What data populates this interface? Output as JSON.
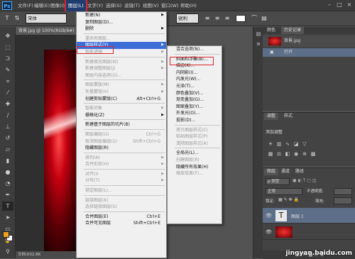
{
  "app": {
    "logo": "Ps"
  },
  "menubar": {
    "items": [
      "文件(F)",
      "编辑(E)",
      "图像(I)",
      "图层(L)",
      "文字(Y)",
      "选择(S)",
      "滤镜(T)",
      "视图(V)",
      "窗口(W)",
      "帮助(H)"
    ],
    "active_index": 3
  },
  "window_controls": {
    "minimize": "–",
    "maximize": "□",
    "close": "×"
  },
  "options": {
    "font_family": "宋体",
    "font_style": "锐利",
    "font_size": "T"
  },
  "document": {
    "tab_label": "背景.jpg @ 100%(RGB/8#)",
    "status": "文档:632.8K"
  },
  "layer_menu": {
    "items": [
      {
        "label": "新建(N)",
        "shortcut": "",
        "arrow": true,
        "disabled": false
      },
      {
        "label": "复制图层(D)...",
        "shortcut": "",
        "arrow": false,
        "disabled": false
      },
      {
        "label": "删除",
        "shortcut": "",
        "arrow": true,
        "disabled": false
      },
      {
        "sep": true
      },
      {
        "label": "重命名图层...",
        "shortcut": "",
        "arrow": false,
        "disabled": true
      },
      {
        "label": "图层样式(Y)",
        "shortcut": "",
        "arrow": true,
        "disabled": false,
        "highlight": true
      },
      {
        "label": "智能滤镜",
        "shortcut": "",
        "arrow": true,
        "disabled": true
      },
      {
        "sep": true
      },
      {
        "label": "新建填充图层(W)",
        "shortcut": "",
        "arrow": true,
        "disabled": true
      },
      {
        "label": "新建调整图层(J)",
        "shortcut": "",
        "arrow": true,
        "disabled": true
      },
      {
        "label": "图层内容选项(O)...",
        "shortcut": "",
        "arrow": false,
        "disabled": true
      },
      {
        "sep": true
      },
      {
        "label": "图层蒙版(M)",
        "shortcut": "",
        "arrow": true,
        "disabled": true
      },
      {
        "label": "矢量蒙版(V)",
        "shortcut": "",
        "arrow": true,
        "disabled": true
      },
      {
        "label": "创建剪贴蒙版(C)",
        "shortcut": "Alt+Ctrl+G",
        "arrow": false,
        "disabled": false
      },
      {
        "sep": true
      },
      {
        "label": "智能对象",
        "shortcut": "",
        "arrow": true,
        "disabled": true
      },
      {
        "label": "栅格化(Z)",
        "shortcut": "",
        "arrow": true,
        "disabled": false
      },
      {
        "sep": true
      },
      {
        "label": "新建基于图层的切片(B)",
        "shortcut": "",
        "arrow": false,
        "disabled": false
      },
      {
        "sep": true
      },
      {
        "label": "图层编组(G)",
        "shortcut": "Ctrl+G",
        "arrow": false,
        "disabled": true
      },
      {
        "label": "取消图层编组(U)",
        "shortcut": "Shift+Ctrl+G",
        "arrow": false,
        "disabled": true
      },
      {
        "label": "隐藏图层(R)",
        "shortcut": "",
        "arrow": false,
        "disabled": false
      },
      {
        "sep": true
      },
      {
        "label": "排列(A)",
        "shortcut": "",
        "arrow": true,
        "disabled": true
      },
      {
        "label": "合并形状(H)",
        "shortcut": "",
        "arrow": true,
        "disabled": true
      },
      {
        "sep": true
      },
      {
        "label": "对齐(I)",
        "shortcut": "",
        "arrow": true,
        "disabled": true
      },
      {
        "label": "分布(T)",
        "shortcut": "",
        "arrow": true,
        "disabled": true
      },
      {
        "sep": true
      },
      {
        "label": "锁定图层(L)...",
        "shortcut": "",
        "arrow": false,
        "disabled": true
      },
      {
        "sep": true
      },
      {
        "label": "链接图层(K)",
        "shortcut": "",
        "arrow": false,
        "disabled": true
      },
      {
        "label": "选择链接图层(S)",
        "shortcut": "",
        "arrow": false,
        "disabled": true
      },
      {
        "sep": true
      },
      {
        "label": "合并图层(E)",
        "shortcut": "Ctrl+E",
        "arrow": false,
        "disabled": false
      },
      {
        "label": "合并可见图层",
        "shortcut": "Shift+Ctrl+E",
        "arrow": false,
        "disabled": false
      }
    ]
  },
  "style_submenu": {
    "items": [
      {
        "label": "混合选项(N)...",
        "disabled": false
      },
      {
        "sep": true
      },
      {
        "label": "斜面和浮雕(B)...",
        "disabled": false,
        "boxed": true
      },
      {
        "label": "描边(K)...",
        "disabled": false
      },
      {
        "label": "内阴影(I)...",
        "disabled": false
      },
      {
        "label": "内发光(W)...",
        "disabled": false
      },
      {
        "label": "光泽(T)...",
        "disabled": false
      },
      {
        "label": "颜色叠加(V)...",
        "disabled": false
      },
      {
        "label": "渐变叠加(G)...",
        "disabled": false
      },
      {
        "label": "图案叠加(Y)...",
        "disabled": false
      },
      {
        "label": "外发光(O)...",
        "disabled": false
      },
      {
        "label": "投影(D)...",
        "disabled": false
      },
      {
        "sep": true
      },
      {
        "label": "拷贝图层样式(C)",
        "disabled": true
      },
      {
        "label": "粘贴图层样式(P)",
        "disabled": true
      },
      {
        "label": "清除图层样式(A)",
        "disabled": true
      },
      {
        "sep": true
      },
      {
        "label": "全局光(L)...",
        "disabled": false
      },
      {
        "label": "创建图层(R)",
        "disabled": true
      },
      {
        "label": "隐藏所有效果(H)",
        "disabled": false
      },
      {
        "label": "缩放效果(F)...",
        "disabled": true
      }
    ]
  },
  "history_panel": {
    "tabs": [
      "颜色",
      "历史记录"
    ],
    "rows": [
      {
        "label": "背景.jpg",
        "thumb": true
      },
      {
        "label": "打开",
        "thumb": false
      }
    ]
  },
  "adjust_panel": {
    "tabs": [
      "调整",
      "样式"
    ],
    "title": "添加调整"
  },
  "layers_panel": {
    "tabs": [
      "图层",
      "通道",
      "路径"
    ],
    "kind_label": "ρ 类型",
    "blend_mode": "正常",
    "opacity_label": "不透明度:",
    "lock_label": "锁定:",
    "fill_label": "填充:",
    "layers": [
      {
        "name": "图层 1",
        "type": "text",
        "icon": "T"
      },
      {
        "name": "",
        "type": "image"
      }
    ]
  },
  "watermark": "jingyan.baidu.com"
}
